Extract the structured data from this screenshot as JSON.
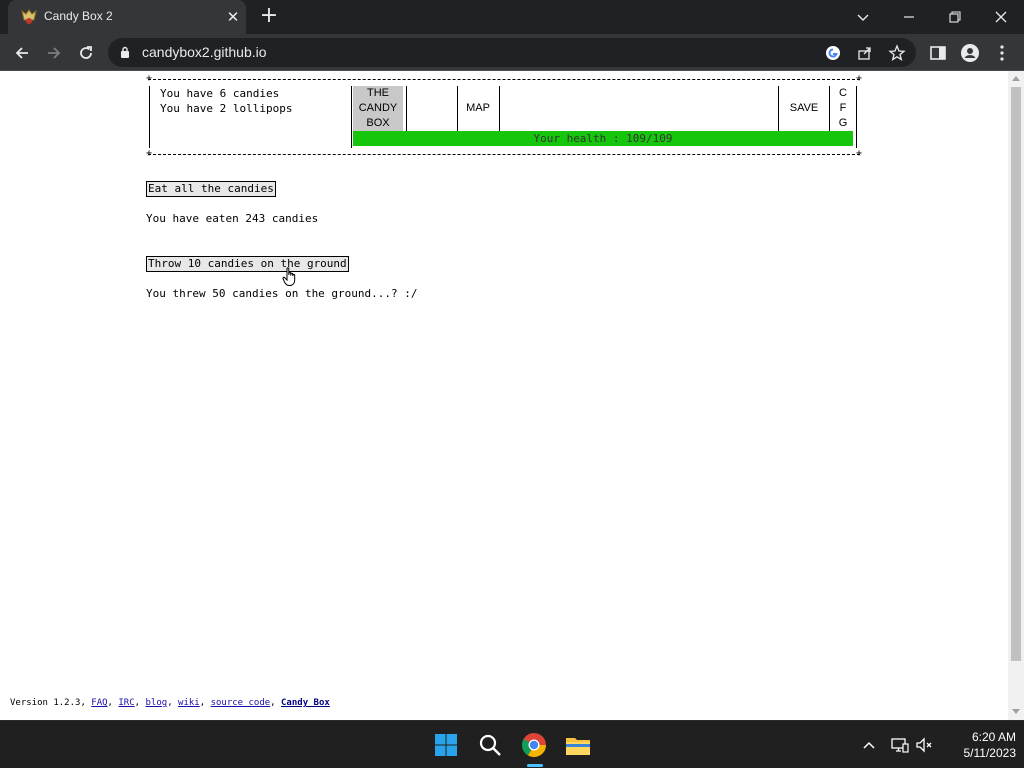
{
  "browser": {
    "tab_title": "Candy Box 2",
    "url": "candybox2.github.io"
  },
  "status": {
    "candies_line": "You have 6 candies",
    "lollipops_line": "You have 2 lollipops",
    "menu": {
      "candy_box": [
        "THE",
        "CANDY",
        "BOX"
      ],
      "map": "MAP",
      "save": "SAVE",
      "cfg": [
        "C",
        "F",
        "G"
      ]
    },
    "health": "Your health : 109/109",
    "health_fraction": 1.0,
    "health_color": "#16c60c"
  },
  "actions": {
    "eat_button": "Eat all the candies",
    "eaten_text": "You have eaten 243 candies",
    "throw_button": "Throw 10 candies on the ground",
    "thrown_text": "You threw 50 candies on the ground...? :/"
  },
  "footer": {
    "version": "Version 1.2.3, ",
    "links": [
      "FAQ",
      "IRC",
      "blog",
      "wiki",
      "source code",
      "Candy Box"
    ],
    "sep": ", "
  },
  "taskbar": {
    "time": "6:20 AM",
    "date": "5/11/2023"
  }
}
